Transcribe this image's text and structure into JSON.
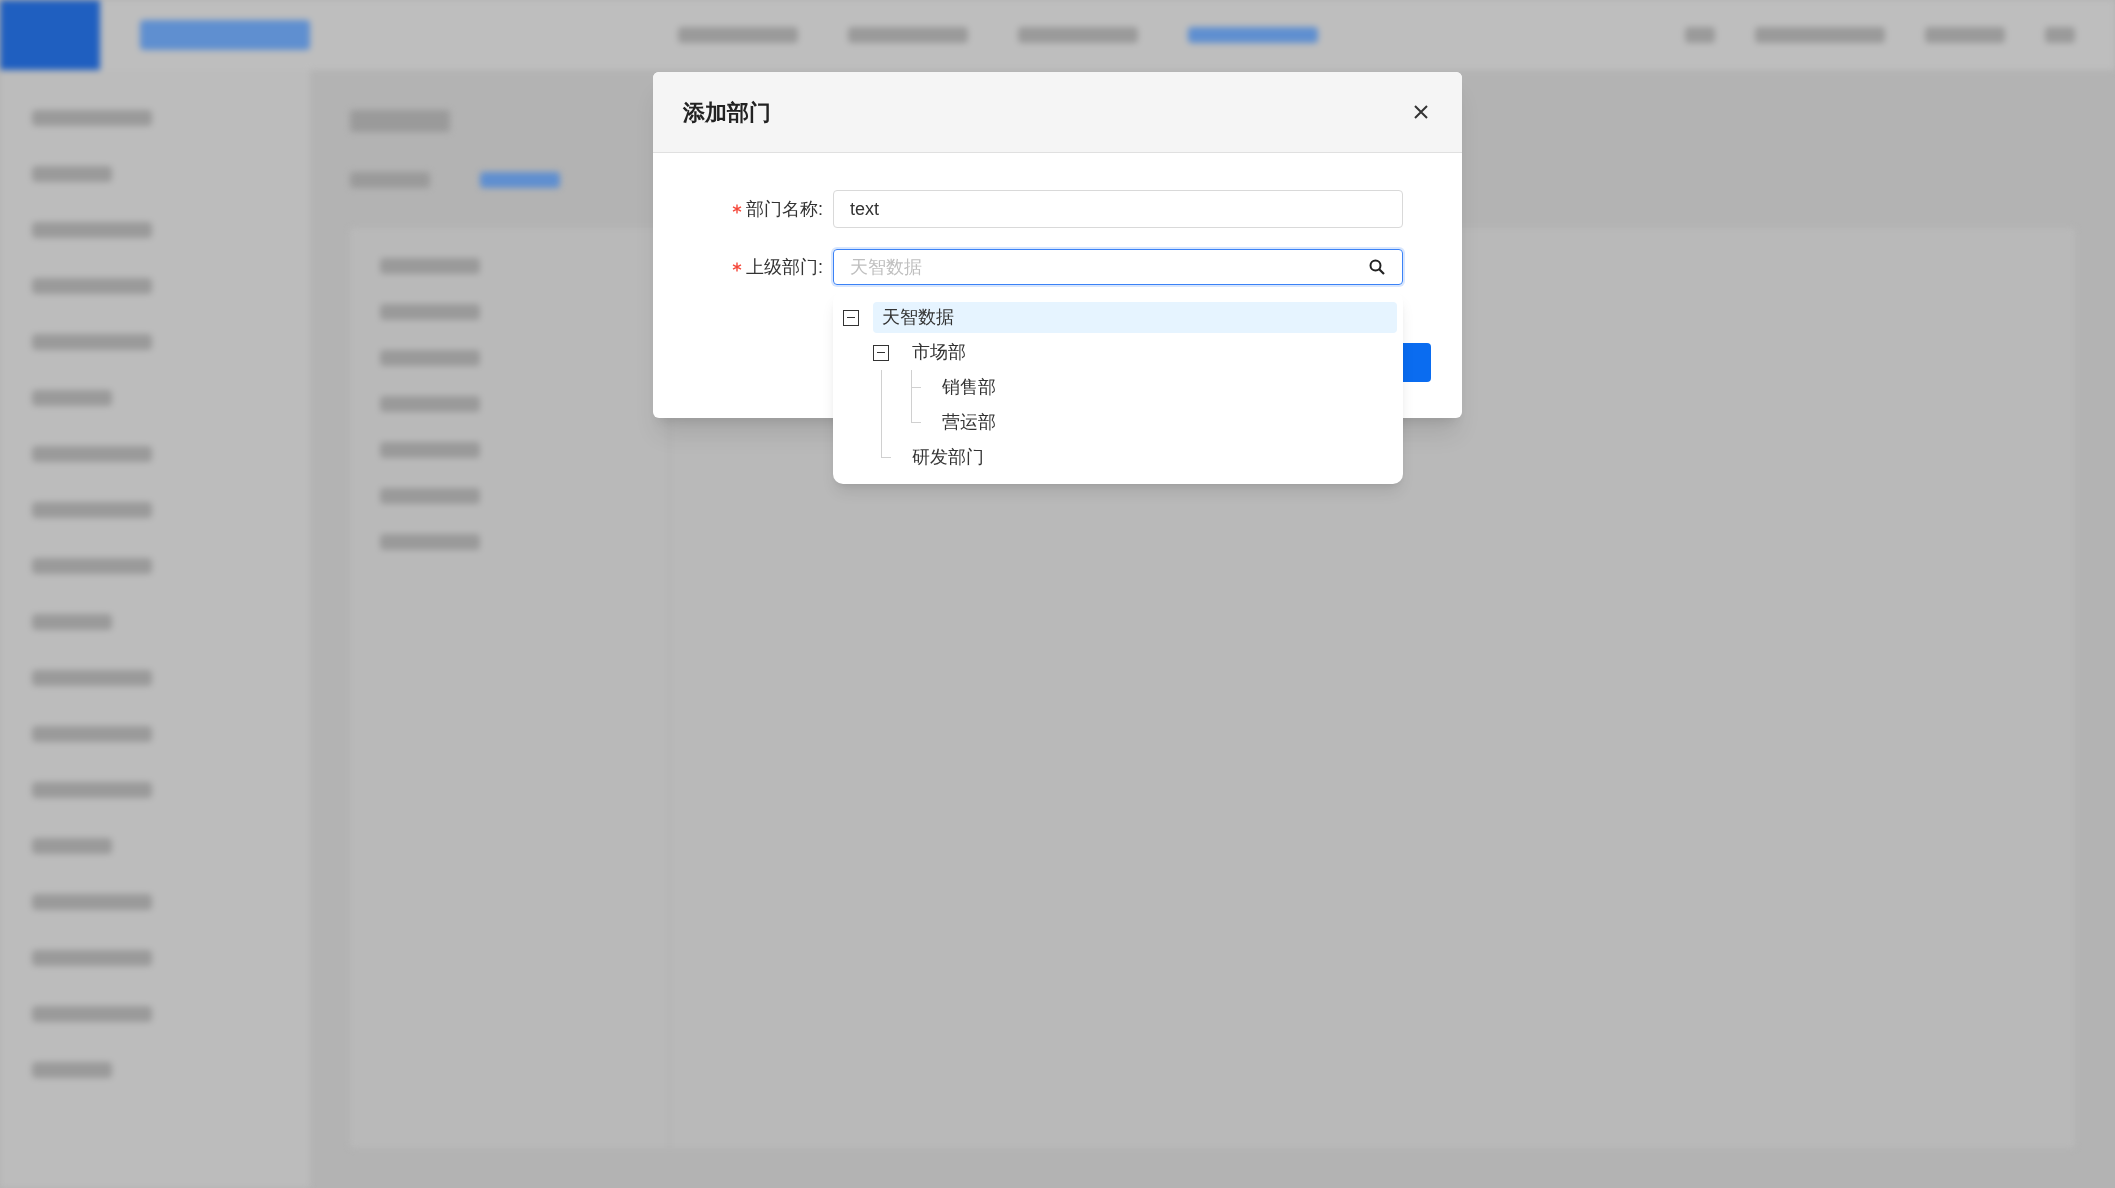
{
  "dialog": {
    "title": "添加部门",
    "fields": [
      {
        "label": "部门名称:",
        "required": true,
        "kind": "text",
        "value": "text"
      },
      {
        "label": "上级部门:",
        "required": true,
        "kind": "tree-select",
        "placeholder": "天智数据",
        "focused": true
      }
    ]
  },
  "tree": [
    {
      "label": "天智数据",
      "selected": true,
      "expanded": true,
      "children": [
        {
          "label": "市场部",
          "selected": false,
          "expanded": true,
          "children": [
            {
              "label": "销售部",
              "selected": false
            },
            {
              "label": "营运部",
              "selected": false
            }
          ]
        },
        {
          "label": "研发部门",
          "selected": false
        }
      ]
    }
  ]
}
